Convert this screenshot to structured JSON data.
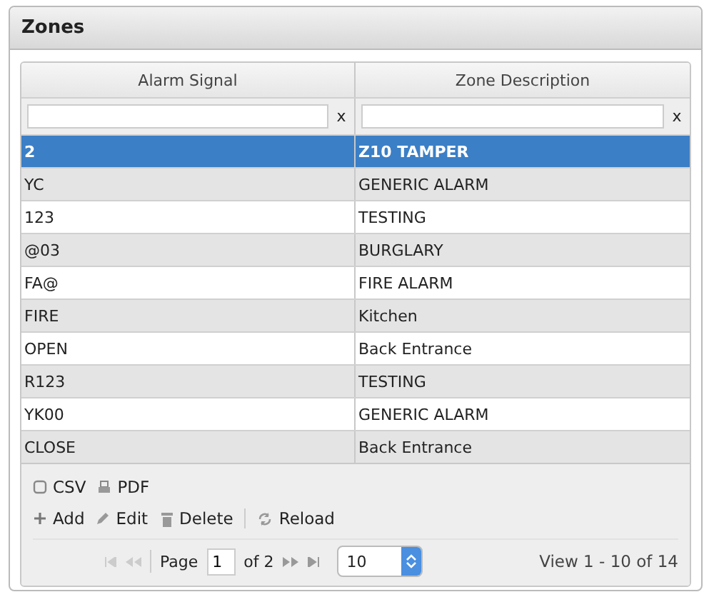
{
  "panel": {
    "title": "Zones"
  },
  "columns": [
    {
      "label": "Alarm Signal",
      "filter_clear": "x"
    },
    {
      "label": "Zone Description",
      "filter_clear": "x"
    }
  ],
  "rows": [
    {
      "signal": "2",
      "description": "Z10 TAMPER",
      "selected": true
    },
    {
      "signal": "YC",
      "description": "GENERIC ALARM",
      "selected": false
    },
    {
      "signal": "123",
      "description": "TESTING",
      "selected": false
    },
    {
      "signal": "@03",
      "description": "BURGLARY",
      "selected": false
    },
    {
      "signal": "FA@",
      "description": "FIRE ALARM",
      "selected": false
    },
    {
      "signal": "FIRE",
      "description": "Kitchen",
      "selected": false
    },
    {
      "signal": "OPEN",
      "description": "Back Entrance",
      "selected": false
    },
    {
      "signal": "R123",
      "description": "TESTING",
      "selected": false
    },
    {
      "signal": "YK00",
      "description": "GENERIC ALARM",
      "selected": false
    },
    {
      "signal": "CLOSE",
      "description": "Back Entrance",
      "selected": false
    }
  ],
  "export_buttons": [
    {
      "label": "CSV",
      "kind": "csv"
    },
    {
      "label": "PDF",
      "kind": "pdf"
    }
  ],
  "actions": [
    {
      "label": "Add",
      "kind": "add"
    },
    {
      "label": "Edit",
      "kind": "edit"
    },
    {
      "label": "Delete",
      "kind": "delete"
    },
    {
      "label": "Reload",
      "kind": "reload"
    }
  ],
  "pager": {
    "page_label": "Page",
    "page": "1",
    "of_label": "of 2",
    "page_size": "10",
    "summary": "View 1 - 10 of 14"
  }
}
